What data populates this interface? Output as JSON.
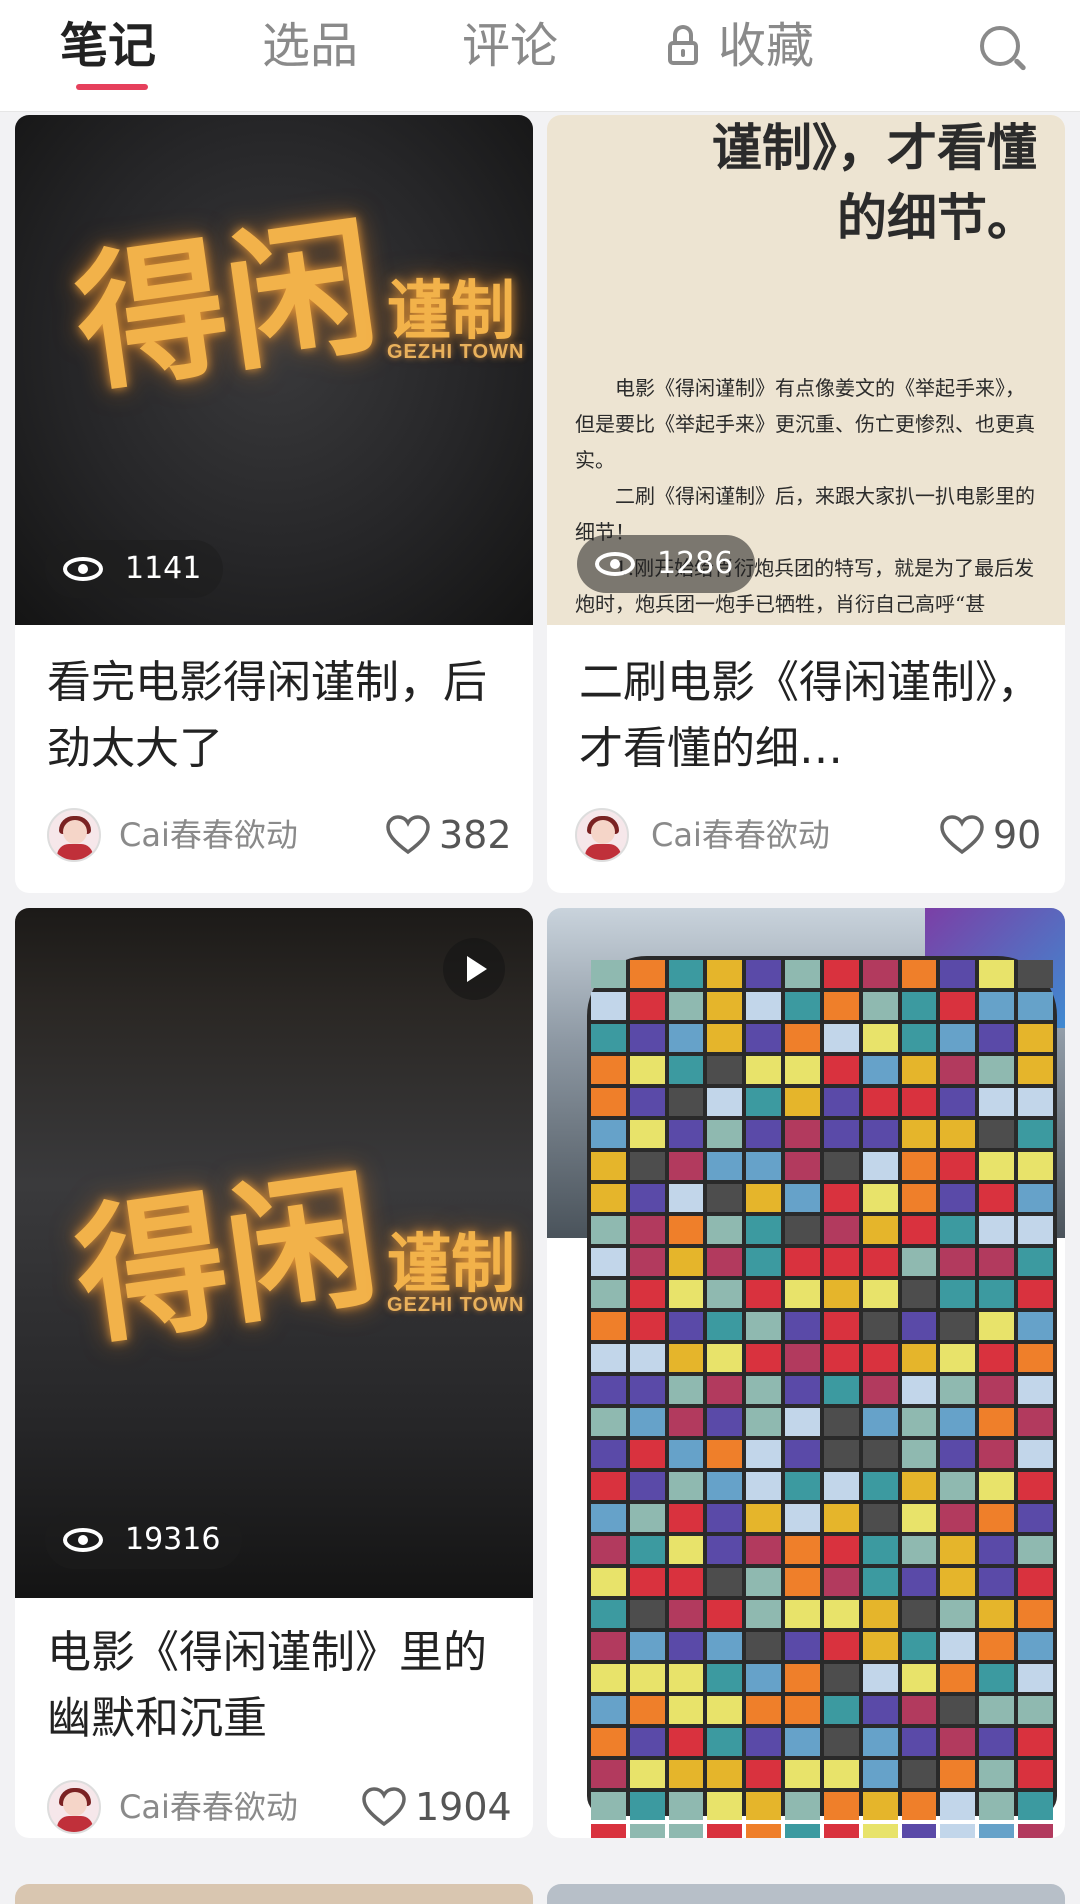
{
  "tabs": {
    "notes": "笔记",
    "products": "选品",
    "comments": "评论",
    "favorites": "收藏"
  },
  "colors": {
    "accent": "#e6405c",
    "logo_gold": "#f2b24a"
  },
  "cards": [
    {
      "title": "看完电影得闲谨制，后劲太大了",
      "views": "1141",
      "author": "Cai春春欲动",
      "likes": "382",
      "logo_cn_1": "得闲",
      "logo_cn_2": "谨制",
      "logo_en": "GEZHI TOWN"
    },
    {
      "title": "二刷电影《得闲谨制》，才看懂的细…",
      "views": "1286",
      "author": "Cai春春欲动",
      "likes": "90",
      "paper_head_1": "谨制》，才看懂",
      "paper_head_2": "的细节。",
      "paper_p1": "电影《得闲谨制》有点像姜文的《举起手来》，但是要比《举起手来》更沉重、伤亡更惨烈、也更真实。",
      "paper_p2": "二刷《得闲谨制》后，来跟大家扒一扒电影里的细节！",
      "paper_p3": "1.刚开始给肖衍炮兵团的特写，就是为了最后发炮时，炮兵团一炮手已牺牲，肖衍自己高呼“甚"
    },
    {
      "title": "电影《得闲谨制》里的幽默和沉重",
      "views": "19316",
      "author": "Cai春春欲动",
      "likes": "1904",
      "logo_cn_1": "得闲",
      "logo_cn_2": "谨制",
      "logo_en": "GEZHI TOWN"
    }
  ]
}
